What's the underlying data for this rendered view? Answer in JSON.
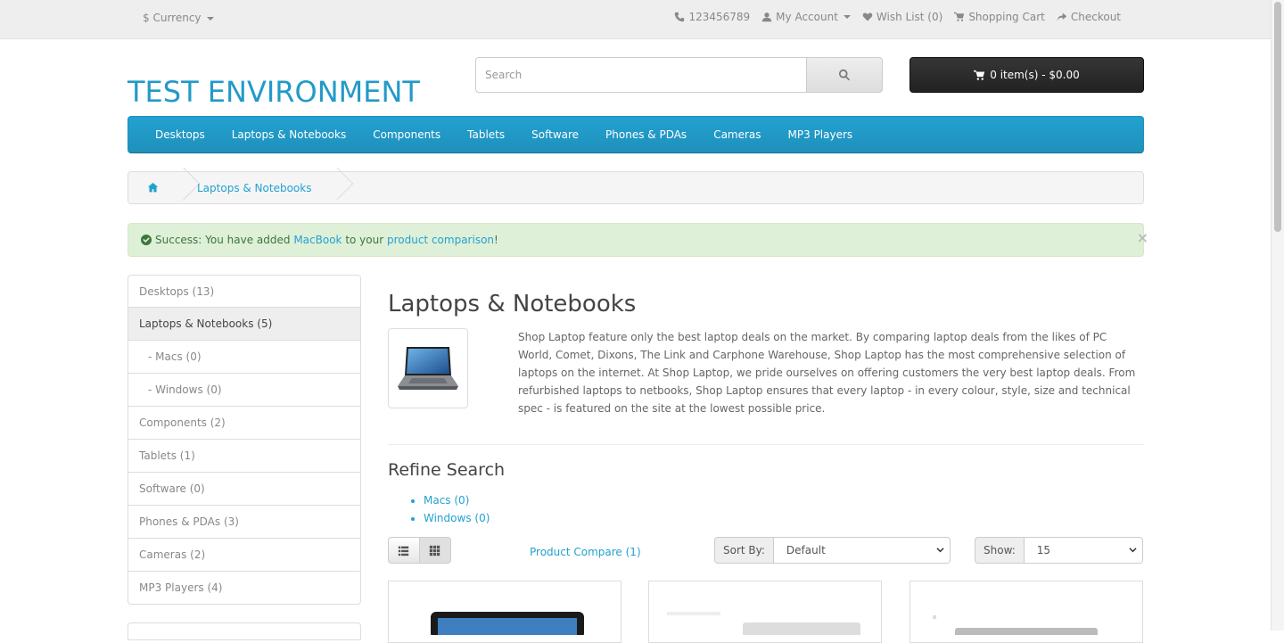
{
  "topbar": {
    "currency_label": "Currency",
    "currency_symbol": "$",
    "links": {
      "phone": "123456789",
      "account": "My Account",
      "wishlist": "Wish List (0)",
      "cart": "Shopping Cart",
      "checkout": "Checkout"
    }
  },
  "header": {
    "logo": "TEST ENVIRONMENT",
    "search_placeholder": "Search",
    "cart_button": "0 item(s) - $0.00"
  },
  "menu": [
    "Desktops",
    "Laptops & Notebooks",
    "Components",
    "Tablets",
    "Software",
    "Phones & PDAs",
    "Cameras",
    "MP3 Players"
  ],
  "breadcrumb": {
    "current": "Laptops & Notebooks"
  },
  "alert": {
    "prefix": "Success: You have added ",
    "product_link": "MacBook",
    "middle": " to your ",
    "comparison_link": "product comparison",
    "suffix": "!",
    "close": "×"
  },
  "sidebar": [
    {
      "label": "Desktops (13)"
    },
    {
      "label": "Laptops & Notebooks (5)"
    },
    {
      "label": "- Macs (0)"
    },
    {
      "label": "- Windows (0)"
    },
    {
      "label": "Components (2)"
    },
    {
      "label": "Tablets (1)"
    },
    {
      "label": "Software (0)"
    },
    {
      "label": "Phones & PDAs (3)"
    },
    {
      "label": "Cameras (2)"
    },
    {
      "label": "MP3 Players (4)"
    }
  ],
  "main": {
    "title": "Laptops & Notebooks",
    "description": "Shop Laptop feature only the best laptop deals on the market. By comparing laptop deals from the likes of PC World, Comet, Dixons, The Link and Carphone Warehouse, Shop Laptop has the most comprehensive selection of laptops on the internet. At Shop Laptop, we pride ourselves on offering customers the very best laptop deals. From refurbished laptops to netbooks, Shop Laptop ensures that every laptop - in every colour, style, size and technical spec - is featured on the site at the lowest possible price.",
    "refine_title": "Refine Search",
    "refine_links": [
      "Macs (0)",
      "Windows (0)"
    ],
    "compare_link": "Product Compare (1)",
    "sort_label": "Sort By:",
    "sort_value": "Default",
    "show_label": "Show:",
    "show_value": "15"
  },
  "colors": {
    "accent": "#23a1d1",
    "cart_bg": "#2a2a2a",
    "alert_bg": "#dff0d8"
  }
}
